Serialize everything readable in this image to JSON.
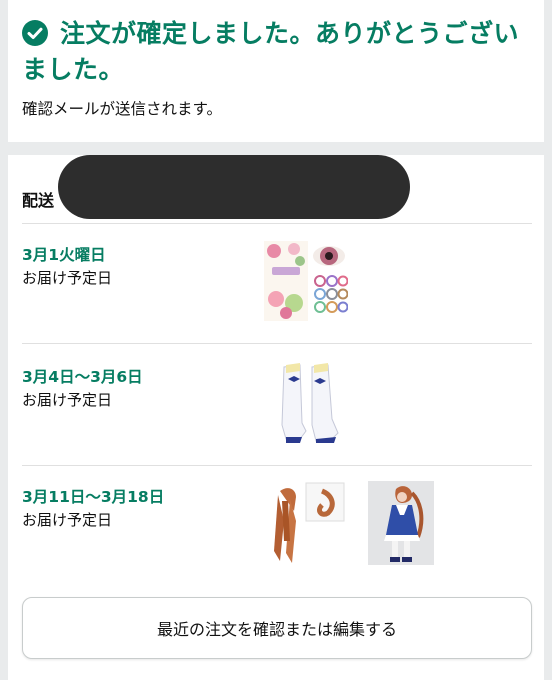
{
  "confirmation": {
    "title_line1": "注文が確定しました。ありがとうござい",
    "title_line2": "ました。",
    "subtitle": "確認メールが送信されます。"
  },
  "orders": {
    "section_label": "配送",
    "groups": [
      {
        "date": "3月1火曜日",
        "label": "お届け予定日"
      },
      {
        "date": "3月4日～3月6日",
        "label": "お届け予定日"
      },
      {
        "date": "3月11日～3月18日",
        "label": "お届け予定日"
      }
    ],
    "edit_button_label": "最近の注文を確認または編集する"
  },
  "colors": {
    "accent": "#067D62",
    "background": "#e9ebec"
  }
}
